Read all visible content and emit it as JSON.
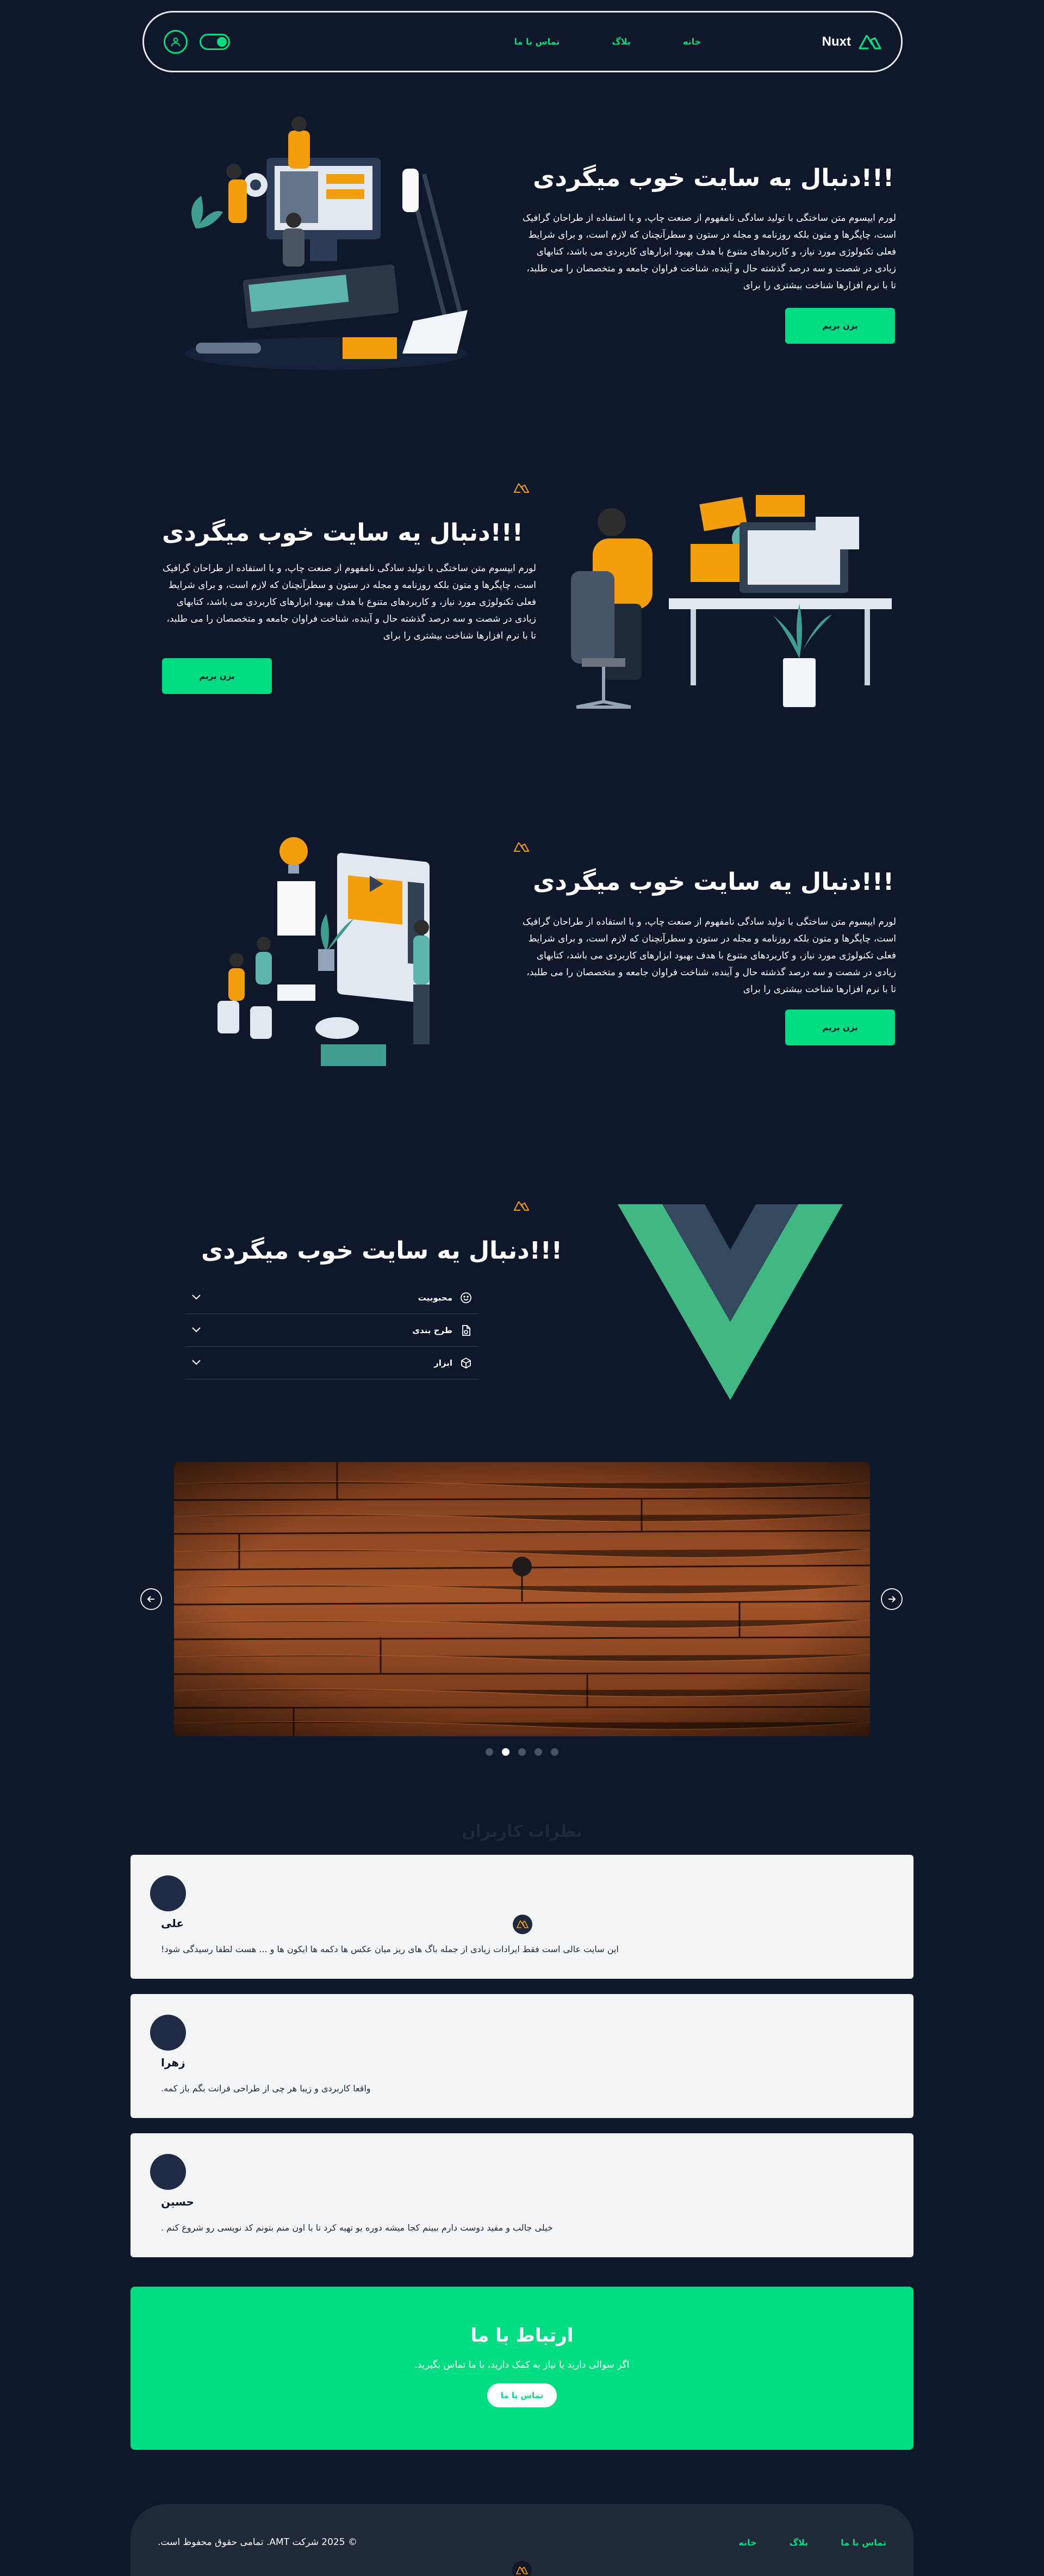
{
  "brand": {
    "name": "Nuxt"
  },
  "nav": {
    "links": [
      "خانه",
      "بلاگ",
      "تماس با ما"
    ]
  },
  "hero_sections": [
    {
      "title": "!!!دنبال یه سایت خوب میگردی",
      "text": "لورم ایپسوم متن ساختگی با تولید سادگی نامفهوم از صنعت چاپ، و با استفاده از طراحان گرافیک است، چاپگرها و متون بلکه روزنامه و مجله در ستون و سطرآنچنان که لازم است، و برای شرایط فعلی تکنولوژی مورد نیاز، و کاربردهای متنوع با هدف بهبود ابزارهای کاربردی می باشد، کتابهای زیادی در شصت و سه درصد گذشته حال و آینده، شناخت فراوان جامعه و متخصصان را می طلبد، تا با نرم افزارها شناخت بیشتری را برای",
      "cta": "بزن بریم"
    },
    {
      "title": "!!!دنبال یه سایت خوب میگردی",
      "text": "لورم ایپسوم متن ساختگی با تولید سادگی نامفهوم از صنعت چاپ، و با استفاده از طراحان گرافیک است، چاپگرها و متون بلکه روزنامه و مجله در ستون و سطرآنچنان که لازم است، و برای شرایط فعلی تکنولوژی مورد نیاز، و کاربردهای متنوع با هدف بهبود ابزارهای کاربردی می باشد، کتابهای زیادی در شصت و سه درصد گذشته حال و آینده، شناخت فراوان جامعه و متخصصان را می طلبد، تا با نرم افزارها شناخت بیشتری را برای",
      "cta": "بزن بریم"
    },
    {
      "title": "!!!دنبال یه سایت خوب میگردی",
      "text": "لورم ایپسوم متن ساختگی با تولید سادگی نامفهوم از صنعت چاپ، و با استفاده از طراحان گرافیک است، چاپگرها و متون بلکه روزنامه و مجله در ستون و سطرآنچنان که لازم است، و برای شرایط فعلی تکنولوژی مورد نیاز، و کاربردهای متنوع با هدف بهبود ابزارهای کاربردی می باشد، کتابهای زیادی در شصت و سه درصد گذشته حال و آینده، شناخت فراوان جامعه و متخصصان را می طلبد، تا با نرم افزارها شناخت بیشتری را برای",
      "cta": "بزن بریم"
    }
  ],
  "accordion": {
    "title": "!!!دنبال یه سایت خوب میگردی",
    "items": [
      {
        "label": "محبوبیت",
        "icon": "smile-icon"
      },
      {
        "label": "طرح بندی",
        "icon": "file-icon"
      },
      {
        "label": "ابزار",
        "icon": "cube-icon"
      }
    ]
  },
  "carousel": {
    "slide_count": 5,
    "active_index": 1
  },
  "testimonials": {
    "heading": "نظرات کاربران",
    "items": [
      {
        "name": "علی",
        "text": "این سایت عالی است فقط ایرادات زیادی از جمله باگ های ریز میان عکس ها دکمه ها ایکون ها و ... هست لطفا رسیدگی شود!"
      },
      {
        "name": "زهرا",
        "text": "واقعا کاربردی و زیبا هر چی از طراحی فرانت بگم باز کمه."
      },
      {
        "name": "حسین",
        "text": "خیلی جالب و مفید دوست دارم ببینم کجا میشه دوره یو تهیه کرد تا با اون منم بتونم کد نویسی رو شروع کنم ."
      }
    ]
  },
  "contact": {
    "title": "ارتباط با ما",
    "text": "اگر سوالی دارید یا نیاز به کمک دارید، با ما تماس بگیرید.",
    "button": "تماس با ما"
  },
  "footer": {
    "copyright": "© 2025 شرکت AMT. تمامی حقوق محفوظ است.",
    "links": [
      "تماس با ما",
      "بلاگ",
      "خانه"
    ]
  },
  "colors": {
    "accent": "#00dc82",
    "background": "#0f172a",
    "card": "#f3f4f6"
  }
}
